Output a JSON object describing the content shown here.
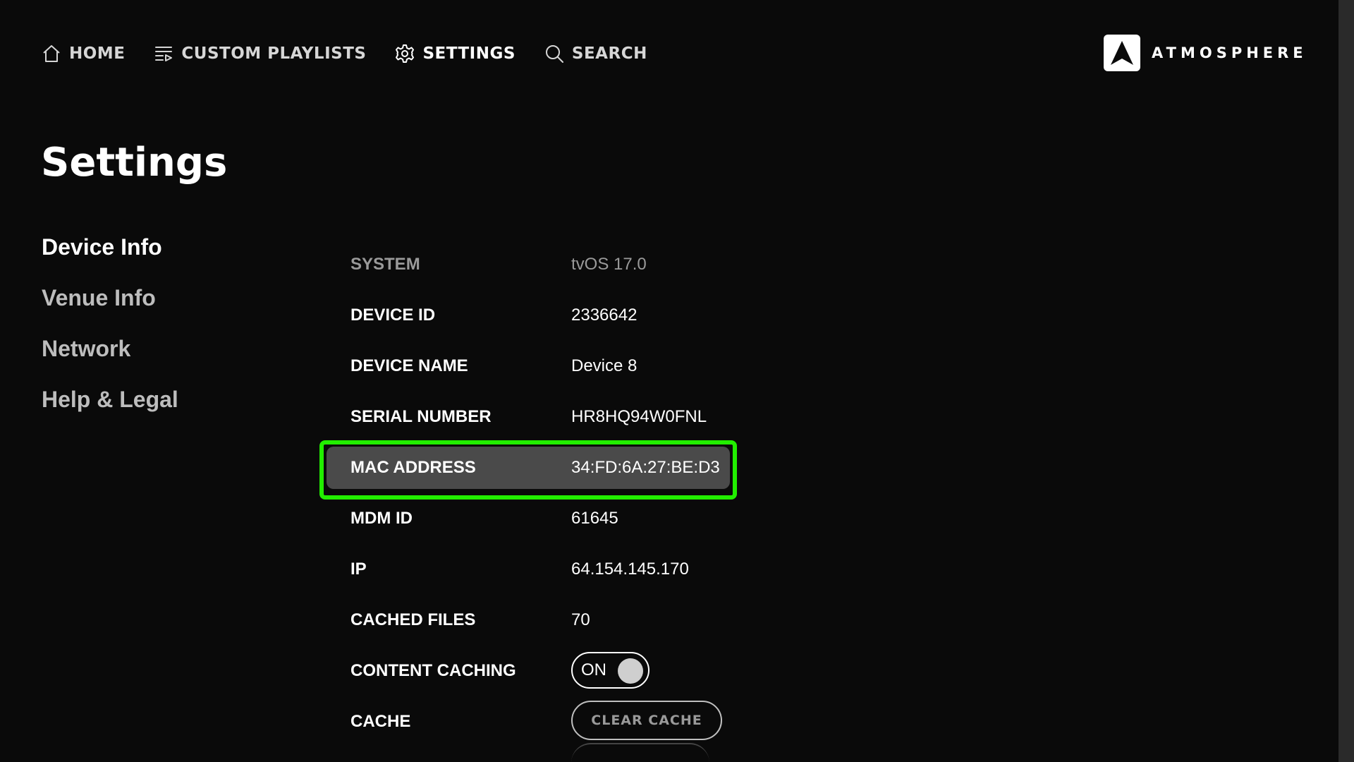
{
  "nav": {
    "items": [
      {
        "label": "HOME",
        "icon": "home-icon"
      },
      {
        "label": "CUSTOM PLAYLISTS",
        "icon": "playlist-icon"
      },
      {
        "label": "SETTINGS",
        "icon": "gear-icon"
      },
      {
        "label": "SEARCH",
        "icon": "search-icon"
      }
    ],
    "active": "SETTINGS"
  },
  "brand": {
    "name": "ATMOSPHERE"
  },
  "page": {
    "title": "Settings"
  },
  "sidebar": {
    "items": [
      {
        "label": "Device Info"
      },
      {
        "label": "Venue Info"
      },
      {
        "label": "Network"
      },
      {
        "label": "Help & Legal"
      }
    ],
    "active": "Device Info"
  },
  "device_info": {
    "rows": [
      {
        "label": "SYSTEM",
        "value": "tvOS 17.0"
      },
      {
        "label": "DEVICE ID",
        "value": "2336642"
      },
      {
        "label": "DEVICE NAME",
        "value": "Device 8"
      },
      {
        "label": "SERIAL NUMBER",
        "value": "HR8HQ94W0FNL"
      },
      {
        "label": "MAC ADDRESS",
        "value": "34:FD:6A:27:BE:D3"
      },
      {
        "label": "MDM ID",
        "value": "61645"
      },
      {
        "label": "IP",
        "value": "64.154.145.170"
      },
      {
        "label": "CACHED FILES",
        "value": "70"
      },
      {
        "label": "CONTENT CACHING",
        "value": "ON"
      },
      {
        "label": "CACHE",
        "value": "CLEAR CACHE"
      }
    ],
    "focused_row": "MAC ADDRESS"
  },
  "colors": {
    "background": "#0a0a0a",
    "focus_ring": "#22ee00",
    "focus_fill": "#4a4a4a",
    "text": "#ffffff",
    "text_dim": "#9a9a9a"
  }
}
